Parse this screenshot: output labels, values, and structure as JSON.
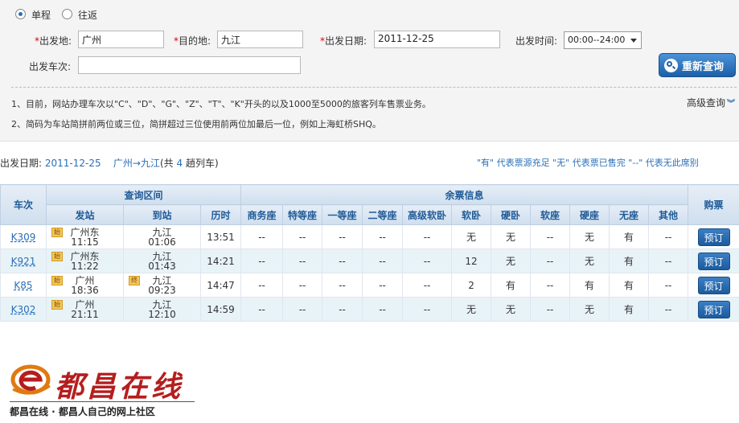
{
  "trip_type": {
    "options": [
      {
        "label": "单程",
        "selected": true
      },
      {
        "label": "往返",
        "selected": false
      }
    ]
  },
  "form": {
    "from_label": "出发地:",
    "from_value": "广州",
    "to_label": "目的地:",
    "to_value": "九江",
    "date_label": "出发日期:",
    "date_value": "2011-12-25",
    "time_label": "出发时间:",
    "time_value": "00:00--24:00",
    "train_no_label": "出发车次:",
    "train_no_value": "",
    "required_mark": "*",
    "query_button": "重新查询"
  },
  "notes": [
    "1、目前，网站办理车次以\"C\"、\"D\"、\"G\"、\"Z\"、\"T\"、\"K\"开头的以及1000至5000的旅客列车售票业务。",
    "2、简码为车站简拼前两位或三位，简拼超过三位使用前两位加最后一位，例如上海虹桥SHQ。"
  ],
  "advanced_query": "高级查询",
  "summary": {
    "date_label": "出发日期:",
    "date": "2011-12-25",
    "route": "广州→九江",
    "count_prefix": "(共",
    "count": "4",
    "count_suffix": "趟列车)"
  },
  "legend": "\"有\" 代表票源充足 \"无\" 代表票已售完 \"--\" 代表无此席别",
  "table": {
    "header_train": "车次",
    "header_range": "查询区间",
    "header_remaining": "余票信息",
    "header_book": "购票",
    "sub_headers": {
      "depart": "发站",
      "arrive": "到站",
      "duration": "历时"
    },
    "seat_headers": [
      "商务座",
      "特等座",
      "一等座",
      "二等座",
      "高级软卧",
      "软卧",
      "硬卧",
      "软座",
      "硬座",
      "无座",
      "其他"
    ],
    "rows": [
      {
        "train": "K309",
        "dep_badge": "始",
        "dep_station": "广州东",
        "dep_time": "11:15",
        "arr_badge": "",
        "arr_station": "九江",
        "arr_time": "01:06",
        "duration": "13:51",
        "seats": [
          "--",
          "--",
          "--",
          "--",
          "--",
          "无",
          "无",
          "--",
          "无",
          "有",
          "--"
        ],
        "book": "预订"
      },
      {
        "train": "K921",
        "dep_badge": "始",
        "dep_station": "广州东",
        "dep_time": "11:22",
        "arr_badge": "",
        "arr_station": "九江",
        "arr_time": "01:43",
        "duration": "14:21",
        "seats": [
          "--",
          "--",
          "--",
          "--",
          "--",
          "12",
          "无",
          "--",
          "无",
          "有",
          "--"
        ],
        "book": "预订"
      },
      {
        "train": "K85",
        "dep_badge": "始",
        "dep_station": "广州",
        "dep_time": "18:36",
        "arr_badge": "终",
        "arr_station": "九江",
        "arr_time": "09:23",
        "duration": "14:47",
        "seats": [
          "--",
          "--",
          "--",
          "--",
          "--",
          "2",
          "有",
          "--",
          "有",
          "有",
          "--"
        ],
        "book": "预订"
      },
      {
        "train": "K302",
        "dep_badge": "始",
        "dep_station": "广州",
        "dep_time": "21:11",
        "arr_badge": "",
        "arr_station": "九江",
        "arr_time": "12:10",
        "duration": "14:59",
        "seats": [
          "--",
          "--",
          "--",
          "--",
          "--",
          "无",
          "无",
          "--",
          "无",
          "有",
          "--"
        ],
        "book": "预订"
      }
    ]
  },
  "logo": {
    "title": "都昌在线",
    "subtitle": "都昌在线 · 都昌人自己的网上社区"
  },
  "colors": {
    "accent": "#2a6fb7",
    "available": "#1e8a1e",
    "soldout": "#999999",
    "brand_red": "#b51e1e"
  }
}
